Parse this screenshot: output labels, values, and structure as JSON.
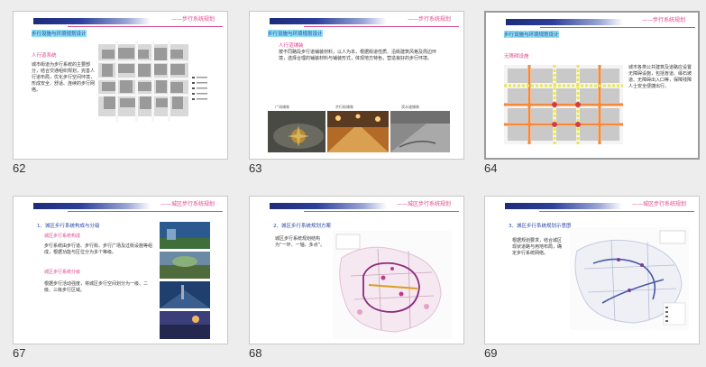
{
  "slides": [
    {
      "number": "62",
      "header": "——步行系统规划",
      "section_title": "步行设施与环境规划设计",
      "heading": "人行道系统",
      "body": "城市街道为步行系统的主要部分，结合交通组织规划，完善人行道布局，优化步行空间环境，形成安全、舒适、连续的步行网络。"
    },
    {
      "number": "63",
      "header": "——步行系统规划",
      "section_title": "步行设施与环境规划设计",
      "heading": "人行道铺装",
      "body": "按不同路段步行道铺装材料，以人为本，根据街道性质、沿街建筑风格及周边环境，选择合理的铺装材料与铺装形式，体现地方特色，营造良好的步行环境。",
      "photo_captions": [
        "广场铺装",
        "步行街铺装",
        "滨水道铺装"
      ]
    },
    {
      "number": "64",
      "header": "——步行系统规划",
      "section_title": "步行设施与环境规划设计",
      "heading": "无障碍设施",
      "body": "城市各类公共建筑及道路应设置无障碍设施，包括盲道、缘石坡道、无障碍出入口等，保障残障人士安全便捷出行。"
    },
    {
      "number": "67",
      "header": "——城区步行系统规划",
      "heading": "1、城区步行系统构成与分级",
      "subheading": "城区步行系统构成",
      "body": "步行系统由步行道、步行街、步行广场及过街设施等组成，根据功能与区位分为多个等级。",
      "subheading2": "城区步行系统分级",
      "body2": "根据步行活动强度，将城区步行空间划分为一级、二级、三级步行区域。"
    },
    {
      "number": "68",
      "header": "——城区步行系统规划",
      "heading": "2、城区步行系统规划方案",
      "body": "城区步行系统规划结构为“一环、一轴、多点”。"
    },
    {
      "number": "69",
      "header": "——城区步行系统规划",
      "heading": "3、城区步行系统规划示意图",
      "body": "根据规划要求，结合城区现状道路与用地布局，确定步行系统网络。"
    }
  ],
  "colors": {
    "accent": "#e0478f",
    "header_blue": "#1d2b7a",
    "title_blue": "#2a46a8",
    "background": "#ededed"
  }
}
